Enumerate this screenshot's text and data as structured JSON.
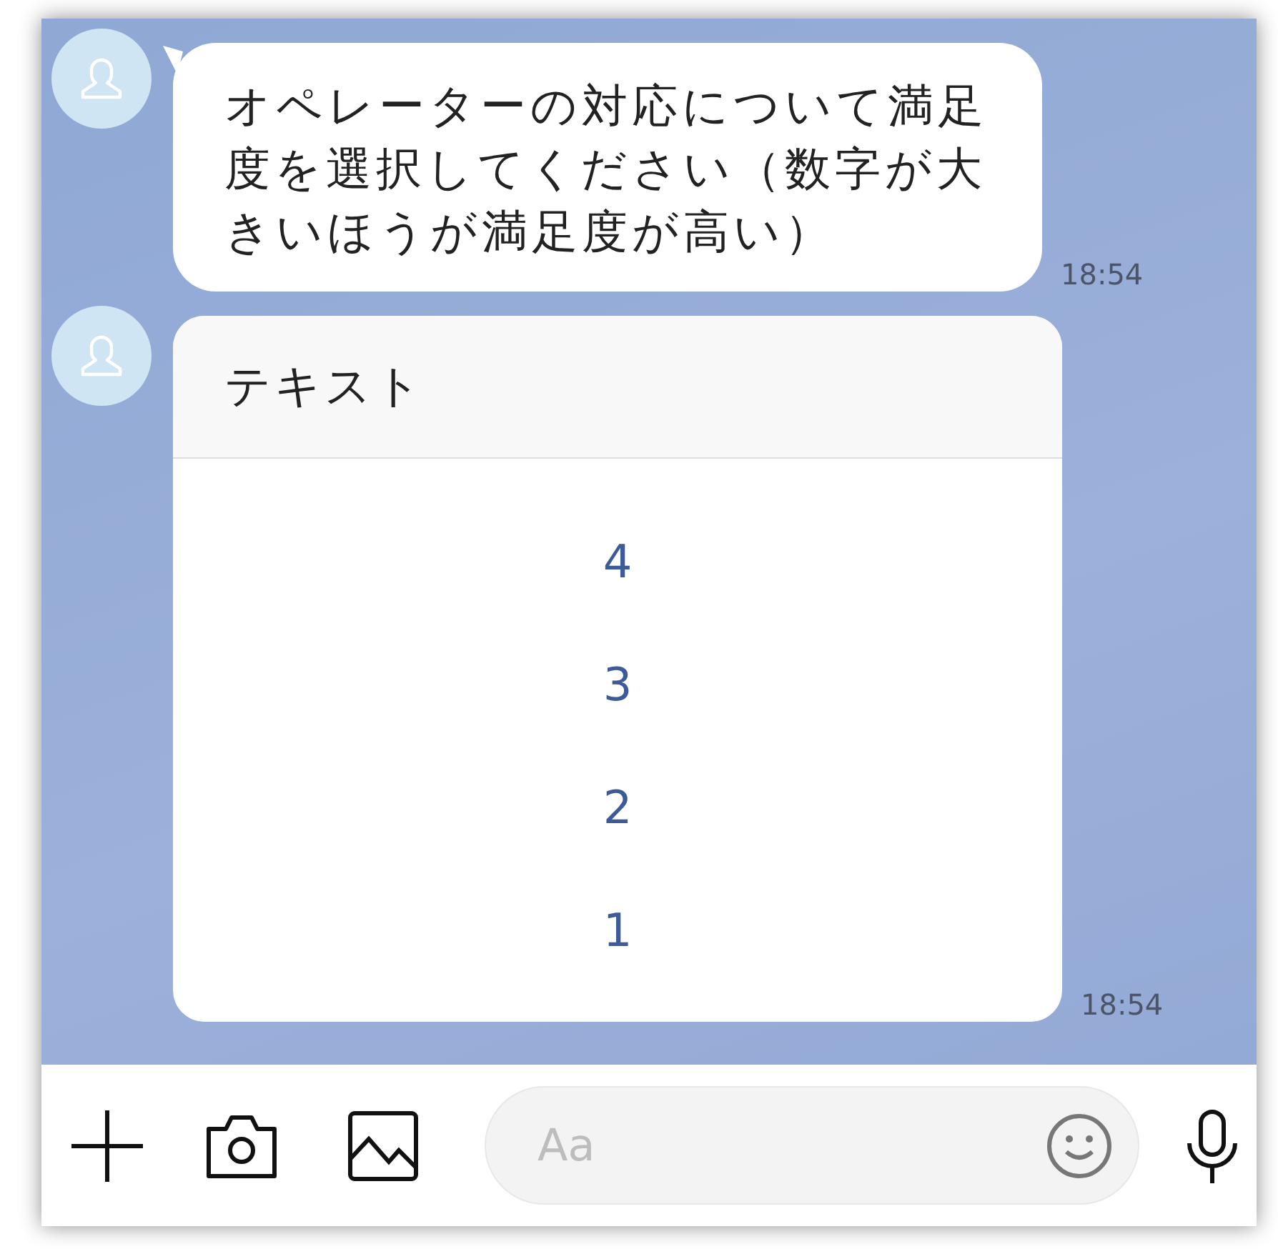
{
  "messages": [
    {
      "kind": "text",
      "text": "オペレーターの対応について満足度を選択してください（数字が大きいほうが満足度が高い）",
      "time": "18:54"
    },
    {
      "kind": "buttons",
      "title": "テキスト",
      "options": [
        "4",
        "3",
        "2",
        "1"
      ],
      "time": "18:54"
    }
  ],
  "input": {
    "placeholder": "Aa"
  }
}
